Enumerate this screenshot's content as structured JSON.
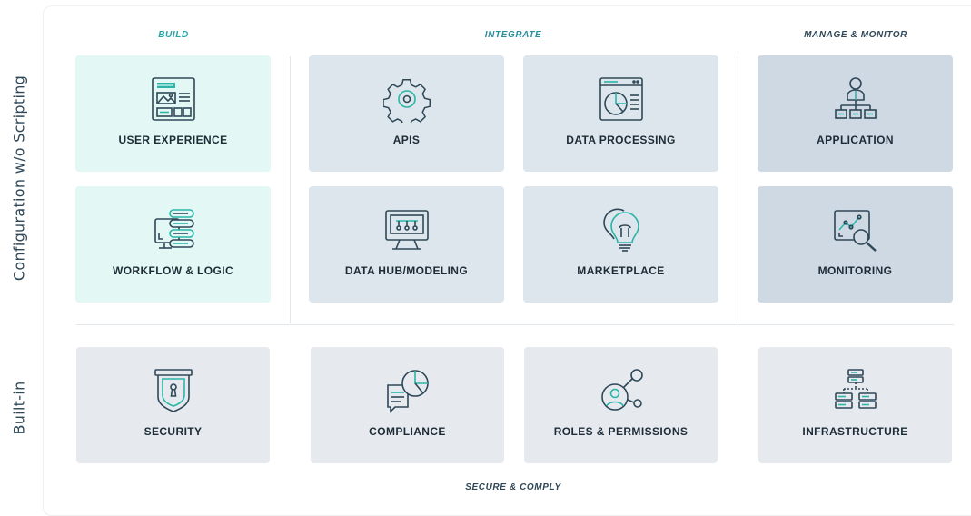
{
  "side_labels": {
    "config": "Configuration w/o Scripting",
    "builtin": "Built-in"
  },
  "sections": {
    "build": "BUILD",
    "integrate": "INTEGRATE",
    "manage": "MANAGE & MONITOR",
    "secure": "SECURE & COMPLY"
  },
  "tiles": {
    "user_experience": "USER EXPERIENCE",
    "apis": "APIS",
    "data_processing": "DATA PROCESSING",
    "application": "APPLICATION",
    "workflow_logic": "WORKFLOW & LOGIC",
    "data_hub": "DATA HUB/MODELING",
    "marketplace": "MARKETPLACE",
    "monitoring": "MONITORING",
    "security": "SECURITY",
    "compliance": "COMPLIANCE",
    "roles_permissions": "ROLES & PERMISSIONS",
    "infrastructure": "INFRASTRUCTURE"
  },
  "colors": {
    "build_tile": "#e3f8f4",
    "integrate_tile": "#dde6ec",
    "manage_tile": "#ced9e4",
    "builtin_tile": "#e6eaef",
    "build_heading": "#2aa3a8",
    "integrate_heading": "#2a8f99",
    "manage_heading": "#2f4858",
    "icon_stroke": "#2f4858",
    "icon_teal": "#2bb5a8"
  },
  "icons": {
    "user_experience": "layout-wireframe-icon",
    "apis": "gear-icon",
    "data_processing": "browser-pie-chart-icon",
    "application": "org-hierarchy-icon",
    "workflow_logic": "monitor-stack-icon",
    "data_hub": "monitor-nodes-icon",
    "marketplace": "lightbulb-icon",
    "monitoring": "chart-magnifier-icon",
    "security": "shield-lock-icon",
    "compliance": "document-pie-icon",
    "roles_permissions": "user-network-icon",
    "infrastructure": "server-tree-icon"
  }
}
